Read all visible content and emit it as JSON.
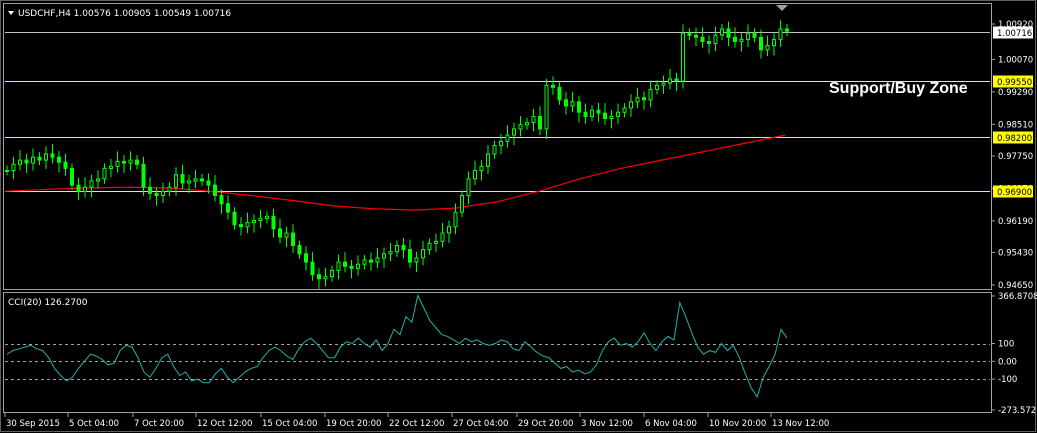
{
  "header": {
    "symbol_info": "USDCHF,H4  1.00576 1.00905 1.00549 1.00716",
    "indicator_info": "CCI(20) 126.2700"
  },
  "annotation": {
    "zone_label": "Support/Buy Zone"
  },
  "price_axis": {
    "ticks": [
      "1.00920",
      "1.00070",
      "0.99290",
      "0.98510",
      "0.97750",
      "0.96970",
      "0.96190",
      "0.95430",
      "0.94650"
    ],
    "current_price": "1.00716",
    "levels": [
      "0.99550",
      "0.98200",
      "0.96900"
    ]
  },
  "cci_axis": {
    "ticks": [
      "366.8708",
      "100",
      "0.00",
      "-100",
      "-273.5727"
    ]
  },
  "time_axis": {
    "labels": [
      "30 Sep 2015",
      "5 Oct 04:00",
      "7 Oct 20:00",
      "12 Oct 12:00",
      "15 Oct 04:00",
      "19 Oct 20:00",
      "22 Oct 12:00",
      "27 Oct 04:00",
      "29 Oct 20:00",
      "3 Nov 12:00",
      "6 Nov 04:00",
      "10 Nov 20:00",
      "13 Nov 12:00"
    ]
  },
  "colors": {
    "background": "#000000",
    "candles": "#00ff00",
    "ma_line": "#ff0000",
    "level_line": "#ffff00",
    "level_label_bg": "#ffff00",
    "cci_line": "#20b2aa",
    "grid_border": "#a0a0a0",
    "current_price_line": "#c0c0c0"
  },
  "chart_data": {
    "type": "candlestick",
    "close_series": [
      0.974,
      0.9755,
      0.9765,
      0.9758,
      0.9772,
      0.9765,
      0.978,
      0.9772,
      0.976,
      0.9745,
      0.9705,
      0.969,
      0.97,
      0.9715,
      0.972,
      0.9745,
      0.975,
      0.9762,
      0.9758,
      0.9765,
      0.9755,
      0.97,
      0.9685,
      0.968,
      0.969,
      0.97,
      0.973,
      0.971,
      0.9715,
      0.972,
      0.9715,
      0.9705,
      0.968,
      0.966,
      0.964,
      0.961,
      0.9605,
      0.9615,
      0.962,
      0.9625,
      0.963,
      0.96,
      0.958,
      0.959,
      0.956,
      0.954,
      0.952,
      0.949,
      0.948,
      0.9485,
      0.95,
      0.952,
      0.951,
      0.9505,
      0.9515,
      0.9525,
      0.952,
      0.953,
      0.954,
      0.9545,
      0.956,
      0.955,
      0.952,
      0.953,
      0.955,
      0.9565,
      0.957,
      0.959,
      0.9605,
      0.964,
      0.968,
      0.972,
      0.974,
      0.975,
      0.978,
      0.98,
      0.981,
      0.9825,
      0.984,
      0.985,
      0.9855,
      0.987,
      0.984,
      0.9945,
      0.994,
      0.991,
      0.9895,
      0.9905,
      0.988,
      0.987,
      0.9885,
      0.9878,
      0.9865,
      0.987,
      0.988,
      0.989,
      0.9905,
      0.9915,
      0.991,
      0.9935,
      0.9945,
      0.995,
      0.996,
      0.9955,
      1.007,
      1.0065,
      1.006,
      1.005,
      1.0045,
      1.0065,
      1.008,
      1.006,
      1.005,
      1.0055,
      1.007,
      1.006,
      1.003,
      1.004,
      1.0055,
      1.008,
      1.0075
    ],
    "ma_series": [
      0.969,
      0.9695,
      0.9698,
      0.97,
      0.9698,
      0.969,
      0.968,
      0.9668,
      0.9655,
      0.9648,
      0.9645,
      0.965,
      0.9665,
      0.969,
      0.972,
      0.9745,
      0.9765,
      0.9785,
      0.9805,
      0.9825
    ],
    "levels": [
      0.9955,
      0.982,
      0.969
    ],
    "current_price": 1.00716,
    "ylim": [
      0.9465,
      1.0092
    ],
    "cci": {
      "value": 126.27,
      "ylim": [
        -273.5727,
        366.8708
      ],
      "levels": [
        100,
        0,
        -100
      ],
      "series": [
        40,
        60,
        70,
        80,
        90,
        70,
        60,
        20,
        -40,
        -80,
        -110,
        -90,
        -40,
        0,
        40,
        30,
        10,
        -20,
        -10,
        60,
        90,
        80,
        20,
        -60,
        -90,
        -40,
        20,
        40,
        -30,
        -80,
        -60,
        -110,
        -100,
        -120,
        -120,
        -70,
        -40,
        -90,
        -120,
        -90,
        -60,
        -40,
        -30,
        20,
        60,
        80,
        60,
        30,
        10,
        70,
        110,
        130,
        100,
        60,
        20,
        20,
        80,
        110,
        100,
        130,
        100,
        80,
        120,
        60,
        100,
        180,
        150,
        250,
        220,
        370,
        300,
        230,
        190,
        150,
        140,
        120,
        100,
        130,
        110,
        120,
        100,
        90,
        100,
        120,
        110,
        70,
        60,
        110,
        80,
        50,
        30,
        20,
        -10,
        -40,
        -30,
        -60,
        -50,
        -70,
        -60,
        -20,
        60,
        110,
        130,
        90,
        100,
        80,
        110,
        160,
        100,
        60,
        110,
        140,
        120,
        330,
        250,
        160,
        80,
        40,
        60,
        50,
        100,
        60,
        90,
        20,
        -70,
        -150,
        -200,
        -90,
        -30,
        40,
        180,
        130
      ]
    }
  }
}
